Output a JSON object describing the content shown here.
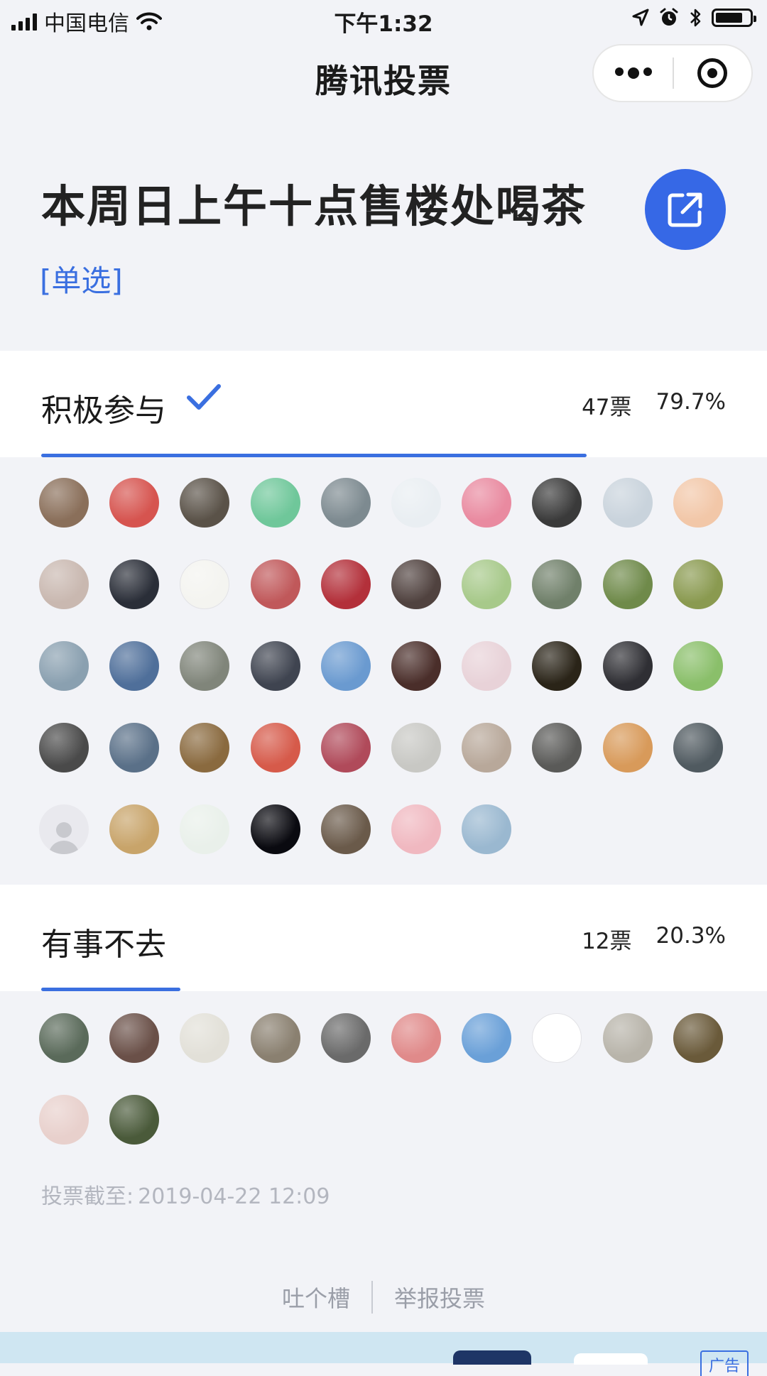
{
  "status_bar": {
    "carrier": "中国电信",
    "time": "下午1:32"
  },
  "nav": {
    "title": "腾讯投票"
  },
  "vote": {
    "title": "本周日上午十点售楼处喝茶",
    "type": "[单选]"
  },
  "options": [
    {
      "label": "积极参与",
      "votes": "47票",
      "percent": "79.7%",
      "share": 0.797,
      "selected": true,
      "avatar_colors": [
        "#8a6f5a",
        "#d6544f",
        "#5a5248",
        "#6fc79a",
        "#7d8a90",
        "#e9eef2",
        "#e98aa0",
        "#3a3a3a",
        "#c9d3dc",
        "#f2c7a8",
        "#c9b8b0",
        "#2a2e38",
        "#f4f4f0",
        "#c0585a",
        "#b3303a",
        "#50423f",
        "#a7c98a",
        "#70806a",
        "#6f8a4a",
        "#8a9a50",
        "#8aa0b0",
        "#4f6f9a",
        "#80857a",
        "#3f4450",
        "#6a9ad0",
        "#4a2e2a",
        "#e8d2d8",
        "#2a2418",
        "#2f2f34",
        "#8abf6a",
        "#4a4a4a",
        "#5a7088",
        "#8a6a3f",
        "#d65a4a",
        "#b04a5a",
        "#c8c8c4",
        "#b8a89a",
        "#5a5a58",
        "#d89a5a",
        "#505a60",
        "placeholder",
        "#c8a46a",
        "#e9f0ea",
        "#0a0a10",
        "#6a5a4a",
        "#f0b8c0",
        "#9ab8d0"
      ]
    },
    {
      "label": "有事不去",
      "votes": "12票",
      "percent": "20.3%",
      "share": 0.203,
      "selected": false,
      "avatar_colors": [
        "#5a6a5a",
        "#6a5048",
        "#e2e0d8",
        "#8a8070",
        "#6a6a6a",
        "#e08a8a",
        "#6aa0d8",
        "#ffffff",
        "#b8b4aa",
        "#6a5a3a",
        "#e8d0cc",
        "#4a5a3a"
      ]
    }
  ],
  "deadline": {
    "label": "投票截至:",
    "value": "2019-04-22 12:09"
  },
  "footer": {
    "feedback": "吐个槽",
    "report": "举报投票"
  },
  "ad": {
    "tag": "广告"
  },
  "colors": {
    "accent": "#3a6fe0",
    "share_button": "#3668e6",
    "background": "#f2f3f7"
  },
  "icons": [
    "signal-icon",
    "wifi-icon",
    "location-icon",
    "alarm-icon",
    "bluetooth-icon",
    "battery-icon",
    "more-icon",
    "close-miniprogram-icon",
    "share-icon",
    "check-icon",
    "default-avatar-icon"
  ]
}
